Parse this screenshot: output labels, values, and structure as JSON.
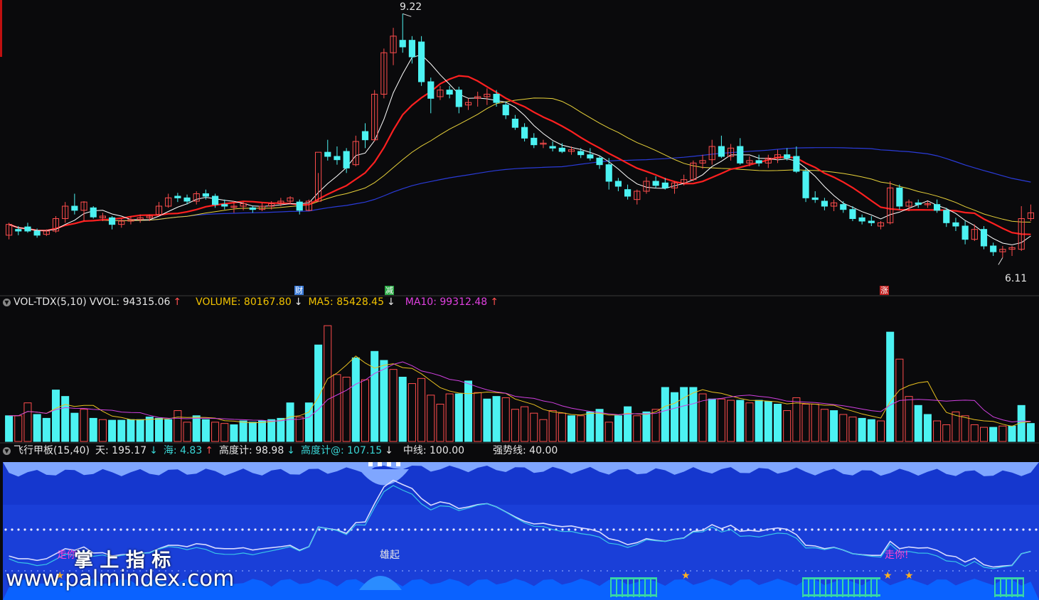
{
  "colors": {
    "up": "#ff4d4d",
    "down": "#4cf2f2",
    "ma_short": "#ffffff",
    "ma_mid": "#ff2020",
    "ma_long": "#e8d23a",
    "ma_slow": "#2a3bd8",
    "vol_ma5": "#e8c020",
    "vol_ma10": "#d040e0",
    "panel_bg": "#0a0a0c",
    "bottom_bg": "#1a3fd8",
    "bottom_top": "#7fa6ff"
  },
  "price_panel": {
    "high_label": "9.22",
    "low_label": "6.11",
    "events": [
      {
        "text": "财",
        "color": "#3a7ad8"
      },
      {
        "text": "减",
        "color": "#2aa845"
      },
      {
        "text": "涨",
        "color": "#c02020"
      }
    ]
  },
  "volume_panel": {
    "name": "VOL-TDX(5,10)",
    "vvol": "VVOL: 94315.06",
    "vvol_arrow": "↑",
    "volume": "VOLUME: 80167.80",
    "volume_arrow": "↓",
    "ma5": "MA5: 85428.45",
    "ma5_arrow": "↓",
    "ma10": "MA10: 99312.48",
    "ma10_arrow": "↑"
  },
  "indicator_panel": {
    "name": "飞行甲板(15,40)",
    "tian": "天: 195.17",
    "tian_arrow": "↓",
    "hai": "海: 4.83",
    "hai_arrow": "↑",
    "gaodu": "高度计: 98.98",
    "gaodu_arrow": "↓",
    "gaodu2": "高度计@: 107.15",
    "gaodu2_arrow": "↓",
    "zhongxian": "中线: 100.00",
    "qiangshi": "强势线: 40.00",
    "signal_left": "走你",
    "signal_mid": "雄起",
    "signal_right": "走你!"
  },
  "watermark": {
    "cn": "掌 上 指 标",
    "url": "www.palmindex.com"
  },
  "chart_data": {
    "type": "candlestick",
    "title": "",
    "xlabel": "",
    "ylabel": "",
    "ylim": [
      6.0,
      9.3
    ],
    "high": 9.22,
    "low": 6.11,
    "candles": [
      [
        6.55,
        6.7,
        6.5,
        6.68
      ],
      [
        6.62,
        6.66,
        6.55,
        6.6
      ],
      [
        6.65,
        6.7,
        6.58,
        6.6
      ],
      [
        6.6,
        6.63,
        6.52,
        6.55
      ],
      [
        6.56,
        6.62,
        6.54,
        6.6
      ],
      [
        6.6,
        6.78,
        6.58,
        6.75
      ],
      [
        6.75,
        6.95,
        6.7,
        6.9
      ],
      [
        6.9,
        7.05,
        6.8,
        6.85
      ],
      [
        6.85,
        6.96,
        6.72,
        6.95
      ],
      [
        6.88,
        6.9,
        6.75,
        6.77
      ],
      [
        6.76,
        6.82,
        6.72,
        6.78
      ],
      [
        6.76,
        6.78,
        6.62,
        6.68
      ],
      [
        6.68,
        6.75,
        6.64,
        6.72
      ],
      [
        6.72,
        6.78,
        6.68,
        6.74
      ],
      [
        6.74,
        6.8,
        6.7,
        6.76
      ],
      [
        6.76,
        6.8,
        6.72,
        6.78
      ],
      [
        6.8,
        6.95,
        6.78,
        6.9
      ],
      [
        6.9,
        7.05,
        6.88,
        7.0
      ],
      [
        7.02,
        7.06,
        6.95,
        7.0
      ],
      [
        7.0,
        7.04,
        6.92,
        6.96
      ],
      [
        6.96,
        7.08,
        6.92,
        7.05
      ],
      [
        7.05,
        7.1,
        6.98,
        7.02
      ],
      [
        7.02,
        7.05,
        6.88,
        6.92
      ],
      [
        6.92,
        6.98,
        6.86,
        6.9
      ],
      [
        6.9,
        6.96,
        6.82,
        6.9
      ],
      [
        6.9,
        6.95,
        6.85,
        6.93
      ],
      [
        6.88,
        6.9,
        6.82,
        6.86
      ],
      [
        6.86,
        6.94,
        6.84,
        6.9
      ],
      [
        6.9,
        6.96,
        6.86,
        6.93
      ],
      [
        6.93,
        7.0,
        6.9,
        6.96
      ],
      [
        6.96,
        7.02,
        6.92,
        7.0
      ],
      [
        6.95,
        6.98,
        6.8,
        6.85
      ],
      [
        6.85,
        6.98,
        6.84,
        6.96
      ],
      [
        6.96,
        7.3,
        6.95,
        7.55
      ],
      [
        7.55,
        7.7,
        7.45,
        7.5
      ],
      [
        7.5,
        7.62,
        7.4,
        7.46
      ],
      [
        7.56,
        7.6,
        7.3,
        7.36
      ],
      [
        7.4,
        7.75,
        7.38,
        7.68
      ],
      [
        7.8,
        7.9,
        7.6,
        7.7
      ],
      [
        7.7,
        8.3,
        7.68,
        8.25
      ],
      [
        8.25,
        8.8,
        8.2,
        8.75
      ],
      [
        8.75,
        9.05,
        8.6,
        8.95
      ],
      [
        8.9,
        9.22,
        8.75,
        8.82
      ],
      [
        8.9,
        8.95,
        8.62,
        8.7
      ],
      [
        8.88,
        8.95,
        8.35,
        8.4
      ],
      [
        8.4,
        8.45,
        8.02,
        8.2
      ],
      [
        8.22,
        8.35,
        8.18,
        8.3
      ],
      [
        8.3,
        8.35,
        8.2,
        8.25
      ],
      [
        8.3,
        8.34,
        8.02,
        8.1
      ],
      [
        8.12,
        8.2,
        8.06,
        8.15
      ],
      [
        8.2,
        8.28,
        8.1,
        8.22
      ],
      [
        8.22,
        8.32,
        8.12,
        8.25
      ],
      [
        8.25,
        8.3,
        8.1,
        8.15
      ],
      [
        8.12,
        8.16,
        7.95,
        8.0
      ],
      [
        7.95,
        8.0,
        7.82,
        7.85
      ],
      [
        7.85,
        7.9,
        7.68,
        7.72
      ],
      [
        7.72,
        7.78,
        7.6,
        7.64
      ],
      [
        7.65,
        7.7,
        7.6,
        7.66
      ],
      [
        7.62,
        7.68,
        7.56,
        7.6
      ],
      [
        7.6,
        7.66,
        7.54,
        7.56
      ],
      [
        7.56,
        7.62,
        7.52,
        7.58
      ],
      [
        7.56,
        7.6,
        7.48,
        7.52
      ],
      [
        7.52,
        7.6,
        7.45,
        7.48
      ],
      [
        7.48,
        7.5,
        7.35,
        7.4
      ],
      [
        7.4,
        7.48,
        7.1,
        7.2
      ],
      [
        7.2,
        7.24,
        7.08,
        7.14
      ],
      [
        7.1,
        7.16,
        6.98,
        7.02
      ],
      [
        6.98,
        7.1,
        6.92,
        7.08
      ],
      [
        7.08,
        7.25,
        7.05,
        7.2
      ],
      [
        7.2,
        7.26,
        7.12,
        7.15
      ],
      [
        7.18,
        7.24,
        7.1,
        7.12
      ],
      [
        7.12,
        7.2,
        7.05,
        7.18
      ],
      [
        7.18,
        7.28,
        7.15,
        7.22
      ],
      [
        7.22,
        7.45,
        7.2,
        7.42
      ],
      [
        7.42,
        7.52,
        7.35,
        7.45
      ],
      [
        7.46,
        7.7,
        7.4,
        7.62
      ],
      [
        7.62,
        7.75,
        7.48,
        7.5
      ],
      [
        7.5,
        7.65,
        7.45,
        7.6
      ],
      [
        7.62,
        7.72,
        7.4,
        7.42
      ],
      [
        7.42,
        7.5,
        7.38,
        7.45
      ],
      [
        7.45,
        7.52,
        7.38,
        7.42
      ],
      [
        7.42,
        7.52,
        7.36,
        7.48
      ],
      [
        7.48,
        7.58,
        7.42,
        7.52
      ],
      [
        7.52,
        7.6,
        7.45,
        7.48
      ],
      [
        7.5,
        7.62,
        7.3,
        7.32
      ],
      [
        7.32,
        7.36,
        6.95,
        7.0
      ],
      [
        7.0,
        7.08,
        6.94,
        6.98
      ],
      [
        6.96,
        7.0,
        6.85,
        6.9
      ],
      [
        6.9,
        6.98,
        6.84,
        6.94
      ],
      [
        6.92,
        6.96,
        6.82,
        6.86
      ],
      [
        6.86,
        6.9,
        6.72,
        6.75
      ],
      [
        6.76,
        6.8,
        6.68,
        6.72
      ],
      [
        6.72,
        6.78,
        6.66,
        6.7
      ],
      [
        6.66,
        6.72,
        6.62,
        6.7
      ],
      [
        6.7,
        7.2,
        6.68,
        7.12
      ],
      [
        7.12,
        7.16,
        6.86,
        6.9
      ],
      [
        6.9,
        6.98,
        6.84,
        6.95
      ],
      [
        6.94,
        6.98,
        6.88,
        6.92
      ],
      [
        6.92,
        6.96,
        6.88,
        6.93
      ],
      [
        6.92,
        6.98,
        6.82,
        6.85
      ],
      [
        6.85,
        6.88,
        6.65,
        6.7
      ],
      [
        6.7,
        6.76,
        6.6,
        6.66
      ],
      [
        6.66,
        6.72,
        6.44,
        6.5
      ],
      [
        6.5,
        6.68,
        6.48,
        6.62
      ],
      [
        6.62,
        6.66,
        6.38,
        6.42
      ],
      [
        6.42,
        6.46,
        6.3,
        6.35
      ],
      [
        6.35,
        6.42,
        6.28,
        6.38
      ],
      [
        6.38,
        6.42,
        6.3,
        6.4
      ],
      [
        6.38,
        6.9,
        6.36,
        6.75
      ],
      [
        6.75,
        6.92,
        6.72,
        6.82
      ]
    ],
    "volumes": [
      [
        40,
        1
      ],
      [
        40,
        0
      ],
      [
        60,
        0
      ],
      [
        42,
        1
      ],
      [
        36,
        1
      ],
      [
        80,
        1
      ],
      [
        70,
        1
      ],
      [
        44,
        1
      ],
      [
        50,
        0
      ],
      [
        36,
        1
      ],
      [
        34,
        0
      ],
      [
        33,
        1
      ],
      [
        33,
        1
      ],
      [
        34,
        1
      ],
      [
        34,
        1
      ],
      [
        38,
        1
      ],
      [
        36,
        1
      ],
      [
        34,
        1
      ],
      [
        48,
        0
      ],
      [
        30,
        0
      ],
      [
        40,
        1
      ],
      [
        34,
        1
      ],
      [
        30,
        0
      ],
      [
        28,
        0
      ],
      [
        26,
        1
      ],
      [
        32,
        1
      ],
      [
        30,
        1
      ],
      [
        32,
        1
      ],
      [
        34,
        1
      ],
      [
        36,
        1
      ],
      [
        60,
        1
      ],
      [
        38,
        0
      ],
      [
        60,
        1
      ],
      [
        150,
        1
      ],
      [
        180,
        0
      ],
      [
        104,
        0
      ],
      [
        100,
        0
      ],
      [
        130,
        1
      ],
      [
        96,
        0
      ],
      [
        140,
        1
      ],
      [
        126,
        1
      ],
      [
        112,
        0
      ],
      [
        100,
        1
      ],
      [
        90,
        0
      ],
      [
        98,
        0
      ],
      [
        72,
        0
      ],
      [
        58,
        0
      ],
      [
        74,
        0
      ],
      [
        74,
        1
      ],
      [
        94,
        1
      ],
      [
        76,
        0
      ],
      [
        66,
        1
      ],
      [
        70,
        1
      ],
      [
        68,
        0
      ],
      [
        50,
        0
      ],
      [
        54,
        0
      ],
      [
        44,
        0
      ],
      [
        34,
        0
      ],
      [
        48,
        0
      ],
      [
        44,
        0
      ],
      [
        40,
        1
      ],
      [
        40,
        0
      ],
      [
        46,
        1
      ],
      [
        50,
        1
      ],
      [
        30,
        0
      ],
      [
        40,
        1
      ],
      [
        54,
        1
      ],
      [
        40,
        0
      ],
      [
        46,
        1
      ],
      [
        50,
        0
      ],
      [
        84,
        1
      ],
      [
        76,
        1
      ],
      [
        84,
        1
      ],
      [
        84,
        1
      ],
      [
        74,
        0
      ],
      [
        66,
        1
      ],
      [
        66,
        0
      ],
      [
        64,
        0
      ],
      [
        64,
        1
      ],
      [
        60,
        0
      ],
      [
        64,
        1
      ],
      [
        62,
        1
      ],
      [
        58,
        1
      ],
      [
        48,
        0
      ],
      [
        68,
        0
      ],
      [
        58,
        0
      ],
      [
        58,
        0
      ],
      [
        50,
        0
      ],
      [
        48,
        1
      ],
      [
        42,
        0
      ],
      [
        38,
        0
      ],
      [
        36,
        1
      ],
      [
        34,
        1
      ],
      [
        32,
        0
      ],
      [
        170,
        1
      ],
      [
        128,
        0
      ],
      [
        70,
        0
      ],
      [
        56,
        1
      ],
      [
        42,
        1
      ],
      [
        32,
        0
      ],
      [
        26,
        0
      ],
      [
        46,
        0
      ],
      [
        40,
        0
      ],
      [
        26,
        0
      ],
      [
        22,
        0
      ],
      [
        22,
        1
      ],
      [
        24,
        0
      ],
      [
        24,
        1
      ],
      [
        56,
        1
      ],
      [
        28,
        1
      ]
    ],
    "volume_ylim": [
      0,
      200
    ]
  }
}
